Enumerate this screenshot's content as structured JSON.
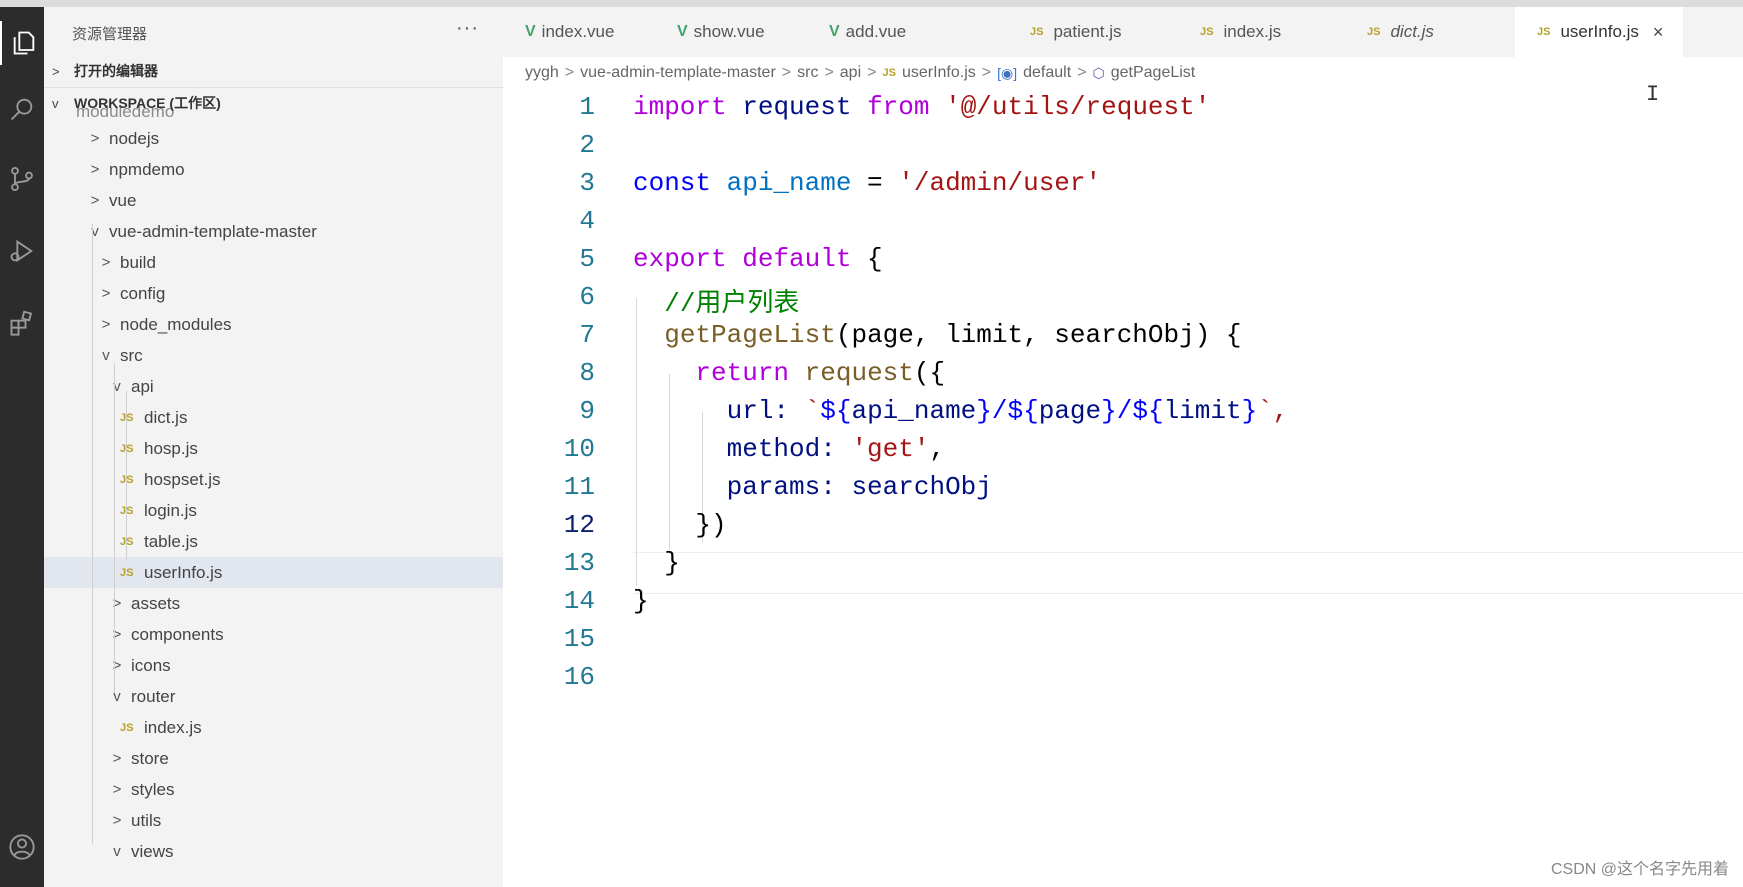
{
  "sidebar": {
    "title": "资源管理器",
    "more": "···",
    "open_editors": "打开的编辑器",
    "workspace": "WORKSPACE (工作区)",
    "partial_top": "moduledemo",
    "items": [
      {
        "label": "nodejs",
        "chev": ">"
      },
      {
        "label": "npmdemo",
        "chev": ">"
      },
      {
        "label": "vue",
        "chev": ">"
      },
      {
        "label": "vue-admin-template-master",
        "chev": "v"
      },
      {
        "label": "build",
        "chev": ">"
      },
      {
        "label": "config",
        "chev": ">"
      },
      {
        "label": "node_modules",
        "chev": ">"
      },
      {
        "label": "src",
        "chev": "v"
      },
      {
        "label": "api",
        "chev": "v"
      },
      {
        "label": "dict.js",
        "badge": "JS"
      },
      {
        "label": "hosp.js",
        "badge": "JS"
      },
      {
        "label": "hospset.js",
        "badge": "JS"
      },
      {
        "label": "login.js",
        "badge": "JS"
      },
      {
        "label": "table.js",
        "badge": "JS"
      },
      {
        "label": "userInfo.js",
        "badge": "JS"
      },
      {
        "label": "assets",
        "chev": ">"
      },
      {
        "label": "components",
        "chev": ">"
      },
      {
        "label": "icons",
        "chev": ">"
      },
      {
        "label": "router",
        "chev": "v"
      },
      {
        "label": "index.js",
        "badge": "JS"
      },
      {
        "label": "store",
        "chev": ">"
      },
      {
        "label": "styles",
        "chev": ">"
      },
      {
        "label": "utils",
        "chev": ">"
      },
      {
        "label": "views",
        "chev": "v"
      }
    ]
  },
  "tabs": [
    {
      "label": "index.vue",
      "icon": "V"
    },
    {
      "label": "show.vue",
      "icon": "V"
    },
    {
      "label": "add.vue",
      "icon": "V"
    },
    {
      "label": "patient.js",
      "icon": "JS"
    },
    {
      "label": "index.js",
      "icon": "JS"
    },
    {
      "label": "dict.js",
      "icon": "JS"
    },
    {
      "label": "userInfo.js",
      "icon": "JS",
      "close": "×"
    }
  ],
  "breadcrumb": {
    "items": [
      "yygh",
      "vue-admin-template-master",
      "src",
      "api",
      "userInfo.js",
      "default",
      "getPageList"
    ],
    "sep": ">"
  },
  "editor": {
    "line_numbers": [
      "1",
      "2",
      "3",
      "4",
      "5",
      "6",
      "7",
      "8",
      "9",
      "10",
      "11",
      "12",
      "13",
      "14",
      "15",
      "16"
    ],
    "tokens": {
      "import": "import",
      "request": "request",
      "from": "from",
      "path": "'@/utils/request'",
      "const": "const",
      "api_name": "api_name",
      "eq": " = ",
      "api_str": "'/admin/user'",
      "export": "export",
      "default": "default",
      "lbrace": " {",
      "comment": "//用户列表",
      "getPageList": "getPageList",
      "params_sig": "(page, limit, searchObj) {",
      "return": "return",
      "req_call": "request",
      "open": "({",
      "url_key": "url: ",
      "tmpl_open": "`",
      "d1": "${",
      "t_api": "api_name",
      "c1": "}/${",
      "t_page": "page",
      "c2": "}/${",
      "t_limit": "limit",
      "c3": "}",
      "tmpl_close": "`,",
      "method_key": "method: ",
      "method_val": "'get'",
      "comma": ",",
      "params_key": "params: ",
      "params_val": "searchObj",
      "close12": "})",
      "close13": "}",
      "close14": "}"
    }
  },
  "cursor_glyph": "I",
  "watermark": "CSDN @这个名字先用着"
}
